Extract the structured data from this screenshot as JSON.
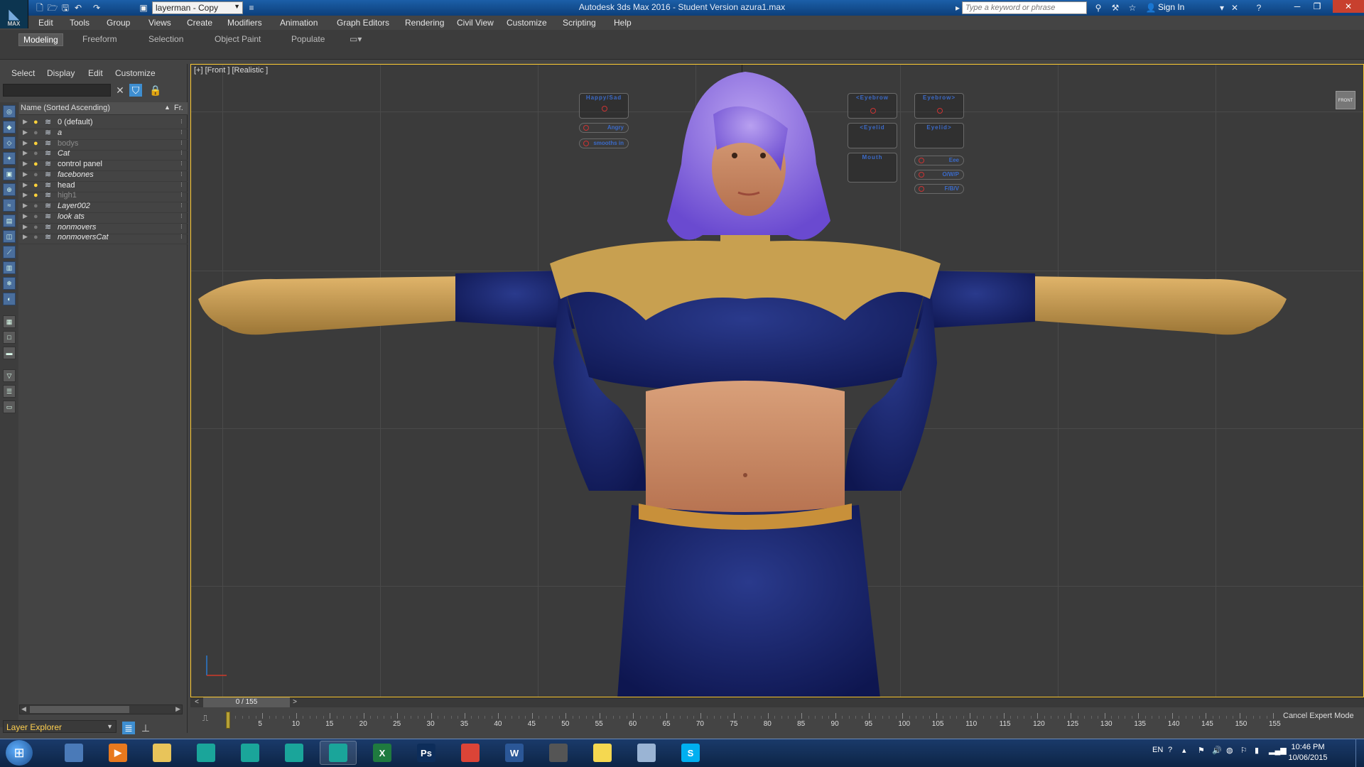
{
  "window": {
    "title": "Autodesk 3ds Max 2016 - Student Version    azura1.max",
    "app_logo": "MAX",
    "workspace": "layerman - Copy",
    "search_placeholder": "Type a keyword or phrase",
    "sign_in": "Sign In"
  },
  "menus": [
    "Edit",
    "Tools",
    "Group",
    "Views",
    "Create",
    "Modifiers",
    "Animation",
    "Graph Editors",
    "Rendering",
    "Civil View",
    "Customize",
    "Scripting",
    "Help"
  ],
  "ribbon_tabs": [
    {
      "label": "Modeling",
      "active": true
    },
    {
      "label": "Freeform",
      "active": false
    },
    {
      "label": "Selection",
      "active": false
    },
    {
      "label": "Object Paint",
      "active": false
    },
    {
      "label": "Populate",
      "active": false
    }
  ],
  "explorer": {
    "menus": [
      "Select",
      "Display",
      "Edit",
      "Customize"
    ],
    "column_name": "Name (Sorted Ascending)",
    "column_fr": "Fr.",
    "layers": [
      {
        "name": "0 (default)",
        "italic": false,
        "dim": false,
        "bulb": "on"
      },
      {
        "name": "a",
        "italic": true,
        "dim": false,
        "bulb": "off"
      },
      {
        "name": "bodys",
        "italic": false,
        "dim": true,
        "bulb": "on"
      },
      {
        "name": "Cat",
        "italic": true,
        "dim": false,
        "bulb": "off"
      },
      {
        "name": "control panel",
        "italic": false,
        "dim": false,
        "bulb": "on"
      },
      {
        "name": "facebones",
        "italic": true,
        "dim": false,
        "bulb": "off"
      },
      {
        "name": "head",
        "italic": false,
        "dim": false,
        "bulb": "on"
      },
      {
        "name": "high1",
        "italic": false,
        "dim": true,
        "bulb": "on"
      },
      {
        "name": "Layer002",
        "italic": true,
        "dim": false,
        "bulb": "off"
      },
      {
        "name": "look ats",
        "italic": true,
        "dim": false,
        "bulb": "off"
      },
      {
        "name": "nonmovers",
        "italic": true,
        "dim": false,
        "bulb": "off"
      },
      {
        "name": "nonmoversCat",
        "italic": true,
        "dim": false,
        "bulb": "off"
      }
    ],
    "footer_label": "Layer Explorer"
  },
  "viewport": {
    "label": "[+] [Front ] [Realistic ]",
    "navcube_label": "FRONT",
    "control_panels": {
      "happy_sad": "Happy/Sad",
      "angry": "Angry",
      "smile": "smooths in",
      "eyebrow_l": "<Eyebrow",
      "eyebrow_r": "Eyebrow>",
      "eyelid_l": "<Eyelid",
      "eyelid_r": "Eyelid>",
      "mouth": "Mouth",
      "eee": "Eee",
      "oo": "O/W/P",
      "ff": "F/B/V"
    }
  },
  "timeline": {
    "frame": "0 / 155",
    "prev": "<",
    "next": ">",
    "ticks": [
      "0",
      "5",
      "10",
      "15",
      "20",
      "25",
      "30",
      "35",
      "40",
      "45",
      "50",
      "55",
      "60",
      "65",
      "70",
      "75",
      "80",
      "85",
      "90",
      "95",
      "100",
      "105",
      "110",
      "115",
      "120",
      "125",
      "130",
      "135",
      "140",
      "145",
      "150",
      "155"
    ],
    "cancel_expert": "Cancel Expert Mode"
  },
  "taskbar": {
    "apps": [
      {
        "name": "remote-desktop",
        "label": "",
        "color": "#4a7ab8"
      },
      {
        "name": "media-player",
        "label": "▶",
        "color": "#e8791e"
      },
      {
        "name": "file-explorer",
        "label": "",
        "color": "#e8c45a"
      },
      {
        "name": "3dsmax-a",
        "label": "",
        "color": "#1aa59a"
      },
      {
        "name": "3dsmax-b",
        "label": "",
        "color": "#1aa59a"
      },
      {
        "name": "maya",
        "label": "",
        "color": "#1aa59a"
      },
      {
        "name": "3dsmax-active",
        "label": "",
        "color": "#1aa59a"
      },
      {
        "name": "excel",
        "label": "X",
        "color": "#1f7a3f"
      },
      {
        "name": "photoshop",
        "label": "Ps",
        "color": "#0d2d5a"
      },
      {
        "name": "chrome",
        "label": "",
        "color": "#db4437"
      },
      {
        "name": "word",
        "label": "W",
        "color": "#2b5797"
      },
      {
        "name": "game-pad",
        "label": "",
        "color": "#555"
      },
      {
        "name": "sticky-notes",
        "label": "",
        "color": "#f5d850"
      },
      {
        "name": "window-app",
        "label": "",
        "color": "#9ab4d4"
      },
      {
        "name": "skype",
        "label": "S",
        "color": "#00aff0"
      }
    ],
    "lang": "EN",
    "time": "10:46 PM",
    "date": "10/06/2015"
  }
}
